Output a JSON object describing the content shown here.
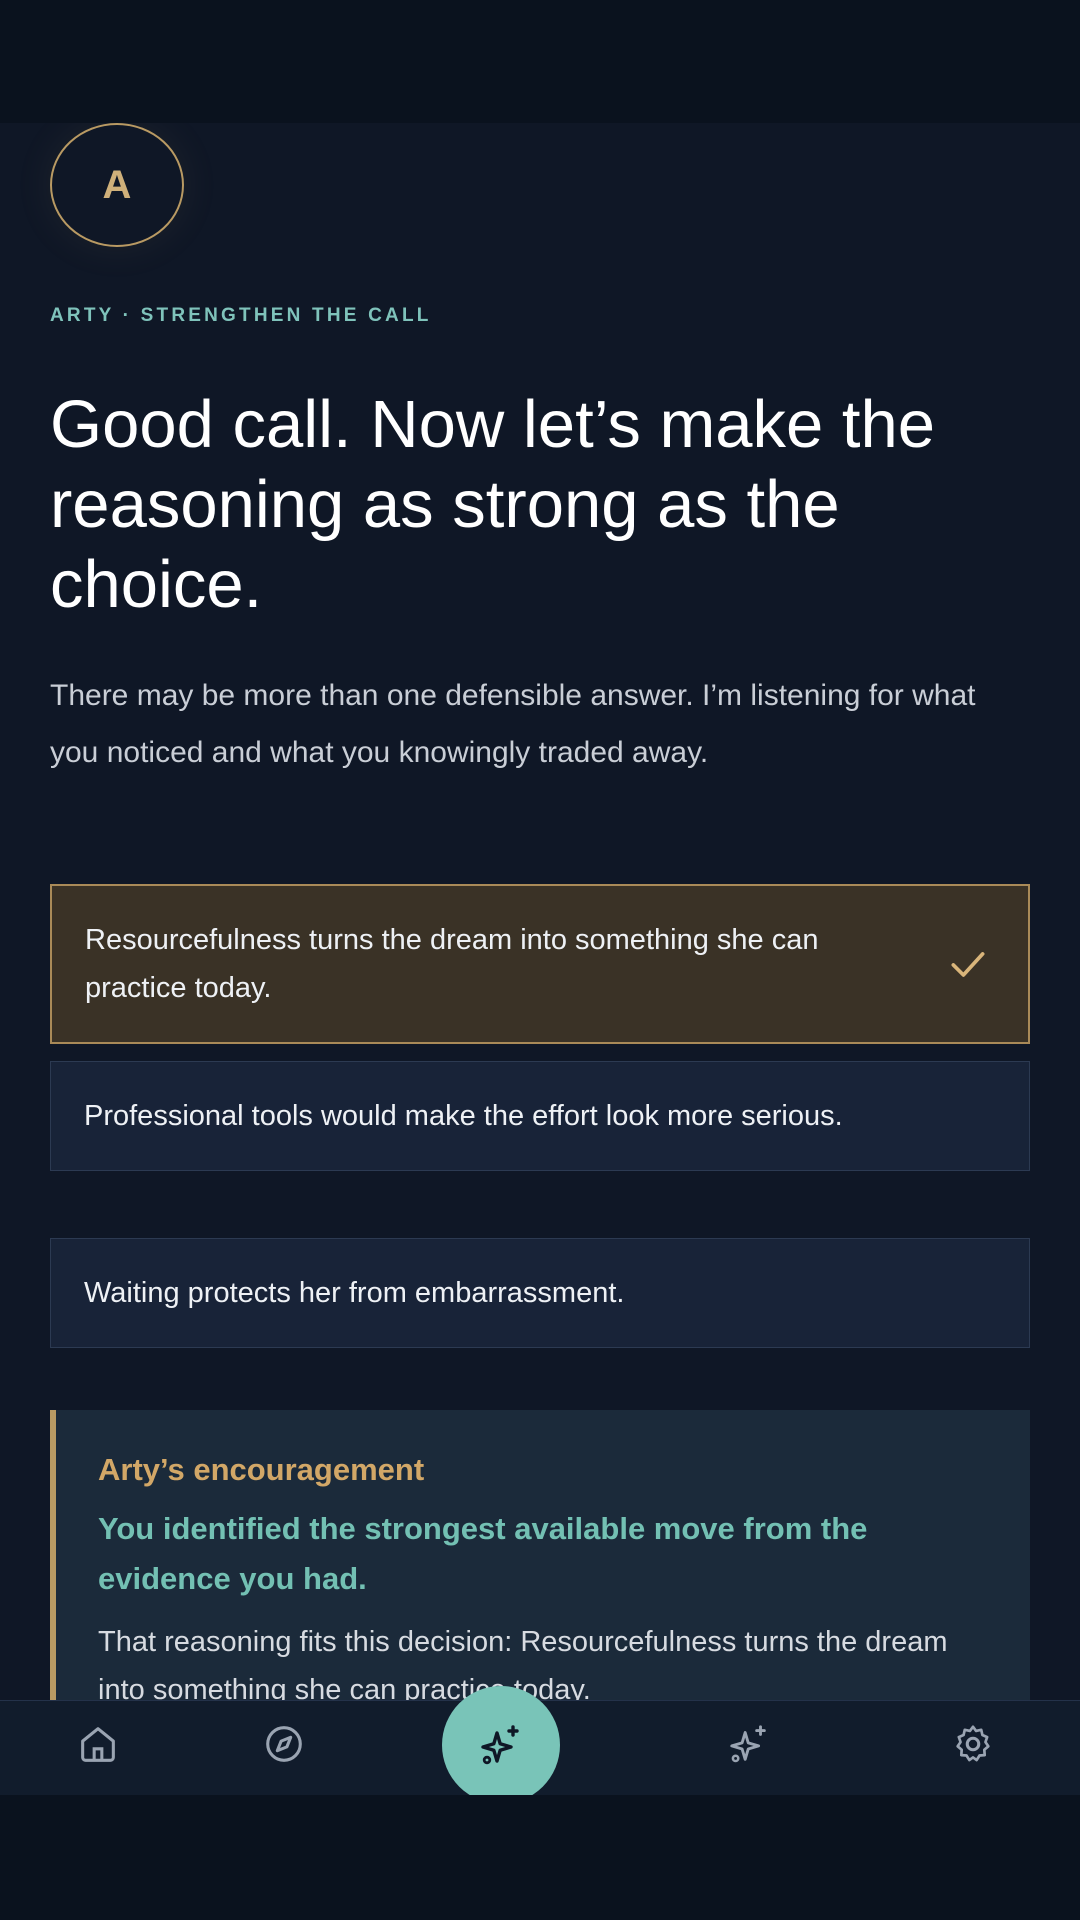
{
  "avatar": {
    "letter": "A"
  },
  "eyebrow": "ARTY · STRENGTHEN THE CALL",
  "headline": "Good call. Now let’s make the reasoning as strong as the choice.",
  "subtext": "There may be more than one defensible answer. I’m listening for what you noticed and what you knowingly traded away.",
  "options": [
    {
      "label": "Resourcefulness turns the dream into something she can practice today.",
      "selected": true
    },
    {
      "label": "Professional tools would make the effort look more serious.",
      "selected": false
    },
    {
      "label": "Waiting protects her from embarrassment.",
      "selected": false
    }
  ],
  "encouragement": {
    "label": "Arty’s encouragement",
    "title": "You identified the strongest available move from the evidence you had.",
    "body": "That reasoning fits this decision: Resourcefulness turns the dream into something she can practice today."
  },
  "nav": {
    "items": [
      "home-icon",
      "compass-icon",
      "sparkle-icon",
      "sparkle-icon",
      "gear-icon"
    ],
    "active": 2
  },
  "colors": {
    "accent_gold": "#b99a63",
    "accent_teal": "#79c4b8",
    "background": "#0f1726",
    "card": "#182338",
    "selected_card": "#3a3226"
  }
}
